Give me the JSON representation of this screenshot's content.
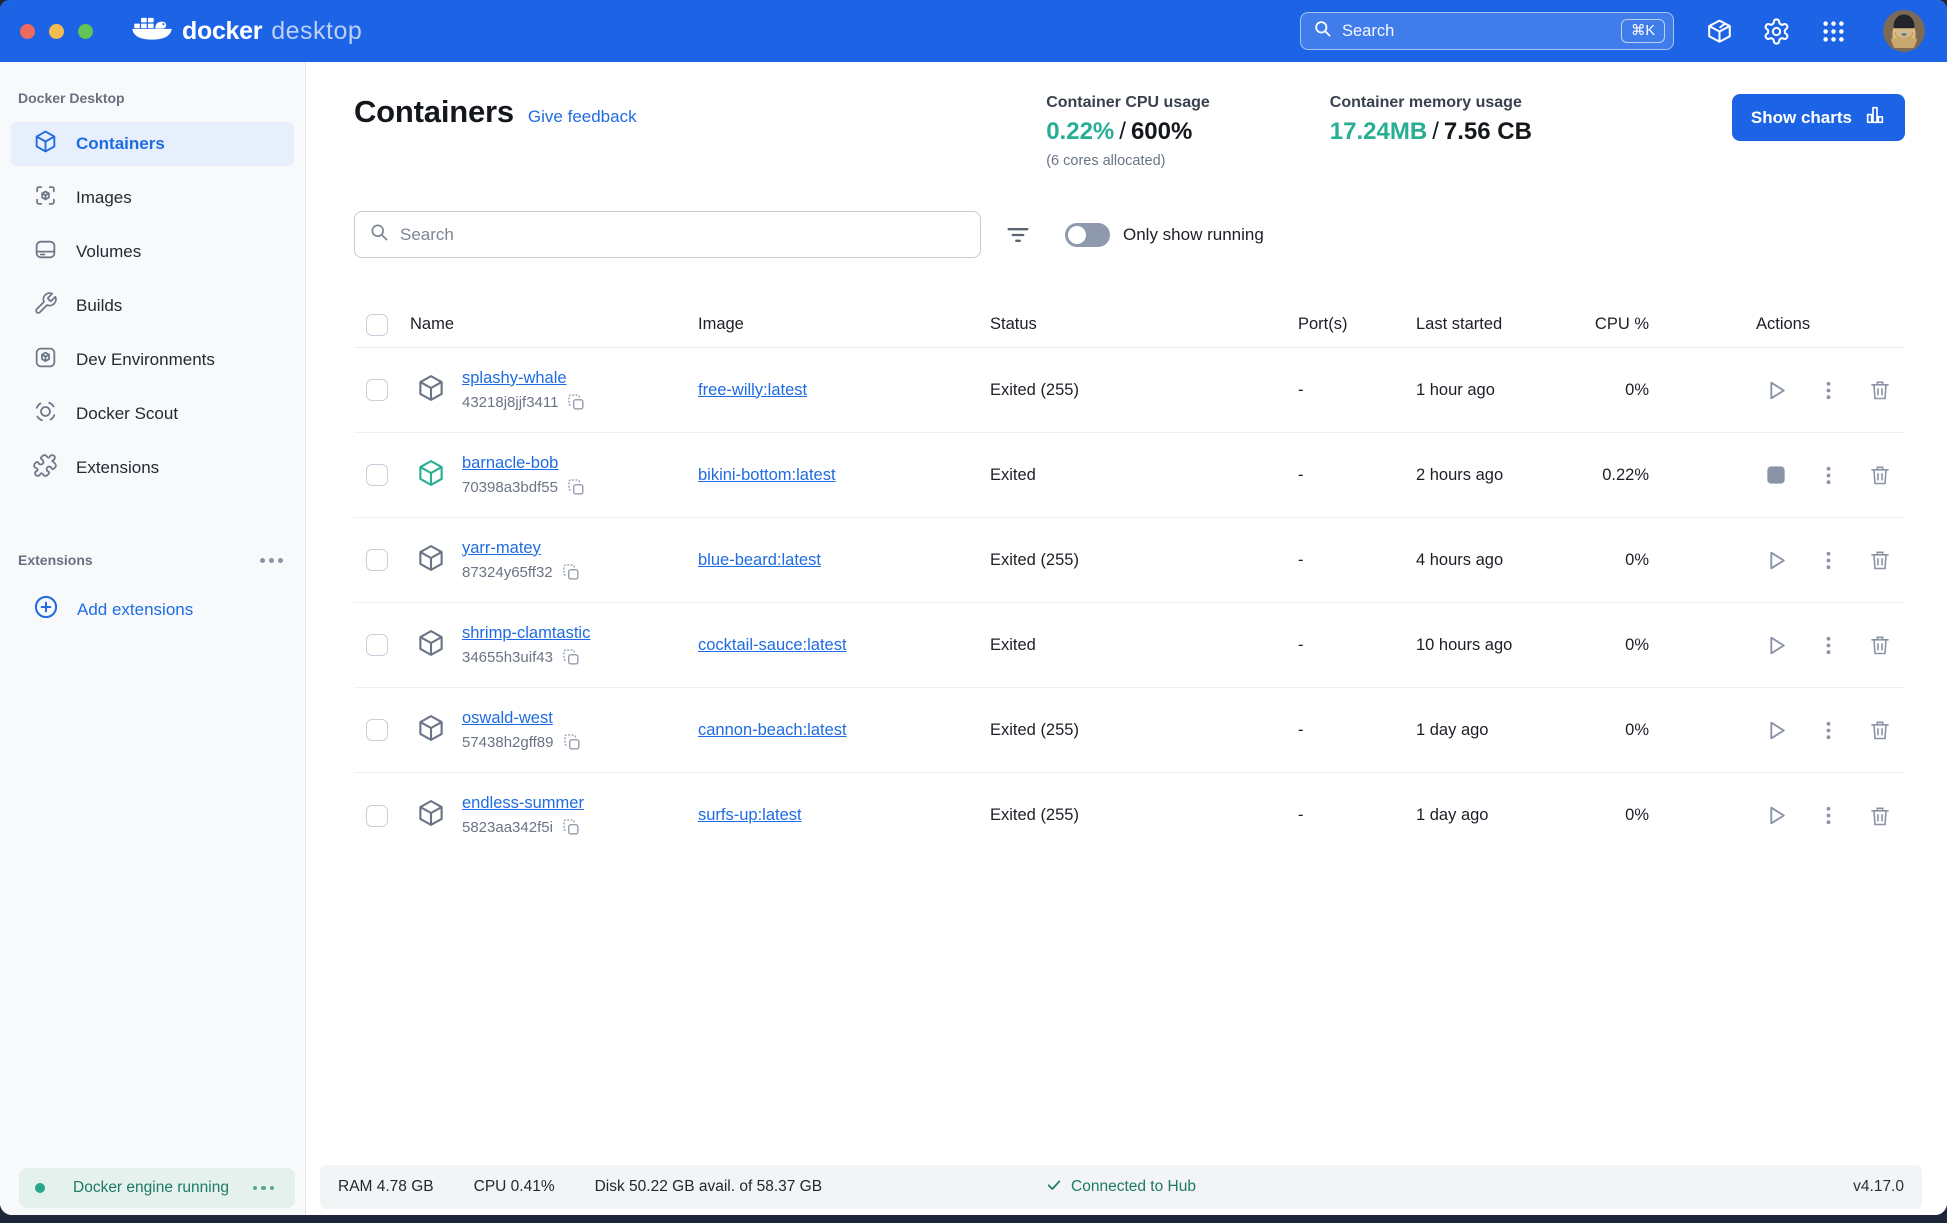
{
  "colors": {
    "topbar_blue": "#1c63e6",
    "accent_blue": "#1f6ce2",
    "teal_value": "#27ae93",
    "engine_green": "#27a58a",
    "slate_icon": "#8a94a6",
    "sidebar_bg": "#f8f9fb",
    "statusbar_bg": "#f2f4f6"
  },
  "topbar": {
    "logo_primary": "docker",
    "logo_secondary": "desktop",
    "search_placeholder": "Search",
    "search_shortcut": "⌘K",
    "icons": [
      "learning-center-icon",
      "settings-gear-icon",
      "apps-grid-icon",
      "user-avatar"
    ]
  },
  "sidebar": {
    "section_label": "Docker Desktop",
    "items": [
      {
        "label": "Containers",
        "active": true
      },
      {
        "label": "Images",
        "active": false
      },
      {
        "label": "Volumes",
        "active": false
      },
      {
        "label": "Builds",
        "active": false
      },
      {
        "label": "Dev Environments",
        "active": false
      },
      {
        "label": "Docker Scout",
        "active": false
      },
      {
        "label": "Extensions",
        "active": false
      }
    ],
    "extensions_section_label": "Extensions",
    "add_extensions_label": "Add extensions",
    "engine_status": "Docker engine running"
  },
  "page": {
    "title": "Containers",
    "feedback_link": "Give feedback",
    "cpu_usage": {
      "label": "Container CPU usage",
      "used": "0.22%",
      "separator": "/",
      "total": "600%",
      "note": "(6 cores allocated)"
    },
    "memory_usage": {
      "label": "Container memory usage",
      "used": "17.24MB",
      "separator": "/",
      "total": "7.56 CB"
    },
    "show_charts_label": "Show charts"
  },
  "toolbar": {
    "search_placeholder": "Search",
    "only_show_running_label": "Only show running"
  },
  "table": {
    "headers": {
      "name": "Name",
      "image": "Image",
      "status": "Status",
      "ports": "Port(s)",
      "last_started": "Last started",
      "cpu": "CPU %",
      "actions": "Actions"
    },
    "rows": [
      {
        "name": "splashy-whale",
        "id": "43218j8jjf3411",
        "image": "free-willy:latest",
        "status": "Exited (255)",
        "ports": "-",
        "last_started": "1 hour ago",
        "cpu": "0%",
        "running": false
      },
      {
        "name": "barnacle-bob",
        "id": "70398a3bdf55",
        "image": "bikini-bottom:latest",
        "status": "Exited",
        "ports": "-",
        "last_started": "2 hours ago",
        "cpu": "0.22%",
        "running": true
      },
      {
        "name": "yarr-matey",
        "id": "87324y65ff32",
        "image": "blue-beard:latest",
        "status": "Exited (255)",
        "ports": "-",
        "last_started": "4 hours ago",
        "cpu": "0%",
        "running": false
      },
      {
        "name": "shrimp-clamtastic",
        "id": "34655h3uif43",
        "image": "cocktail-sauce:latest",
        "status": "Exited",
        "ports": "-",
        "last_started": "10 hours ago",
        "cpu": "0%",
        "running": false
      },
      {
        "name": "oswald-west",
        "id": "57438h2gff89",
        "image": "cannon-beach:latest",
        "status": "Exited (255)",
        "ports": "-",
        "last_started": "1 day ago",
        "cpu": "0%",
        "running": false
      },
      {
        "name": "endless-summer",
        "id": "5823aa342f5i",
        "image": "surfs-up:latest",
        "status": "Exited (255)",
        "ports": "-",
        "last_started": "1 day ago",
        "cpu": "0%",
        "running": false
      }
    ]
  },
  "statusbar": {
    "ram": "RAM 4.78 GB",
    "cpu": "CPU 0.41%",
    "disk": "Disk 50.22 GB avail. of 58.37 GB",
    "hub_status": "Connected to Hub",
    "version": "v4.17.0"
  }
}
